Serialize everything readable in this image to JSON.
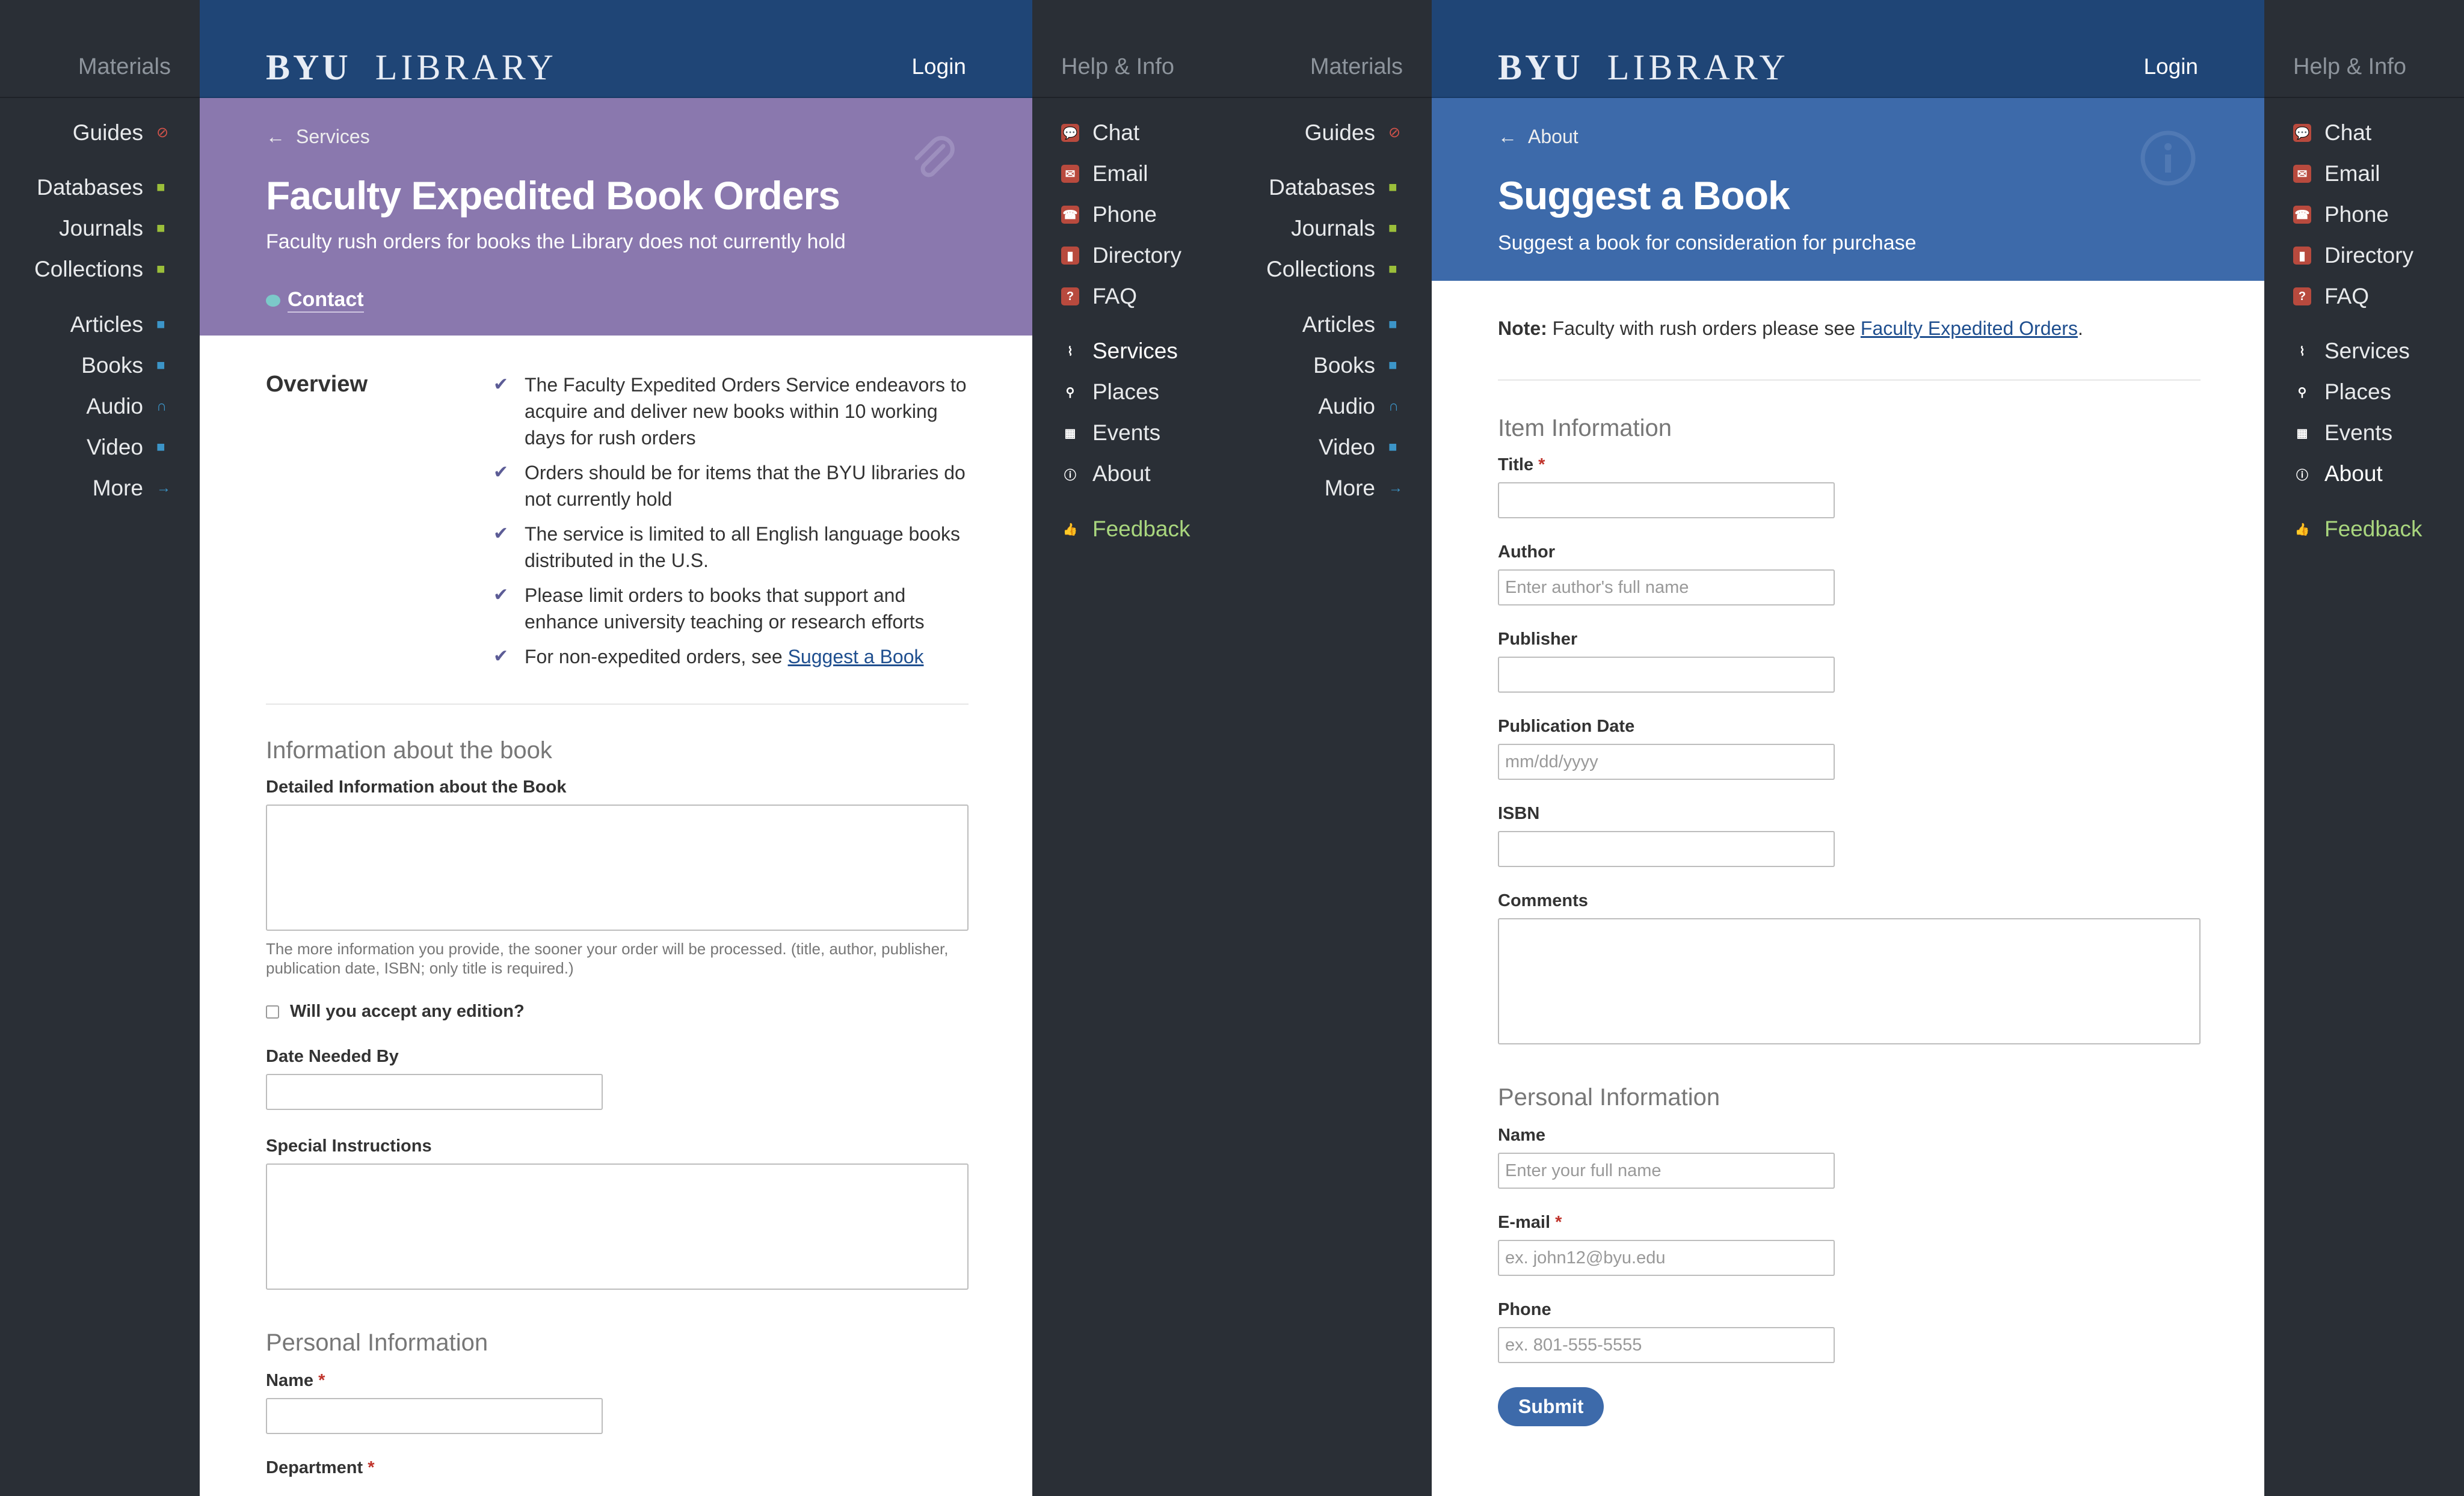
{
  "left_panel": {
    "materials_label": "Materials",
    "items": [
      {
        "label": "Guides",
        "icon": "guides-icon",
        "color": "#d0524a"
      },
      {
        "label": "Databases",
        "icon": "databases-icon",
        "color": "#9bbf3a"
      },
      {
        "label": "Journals",
        "icon": "journals-icon",
        "color": "#9bbf3a"
      },
      {
        "label": "Collections",
        "icon": "collections-icon",
        "color": "#9bbf3a"
      },
      {
        "label": "Articles",
        "icon": "articles-icon",
        "color": "#3c95c8"
      },
      {
        "label": "Books",
        "icon": "books-icon",
        "color": "#3c95c8"
      },
      {
        "label": "Audio",
        "icon": "audio-icon",
        "color": "#3c95c8"
      },
      {
        "label": "Video",
        "icon": "video-icon",
        "color": "#3c95c8"
      },
      {
        "label": "More",
        "icon": "arrow-right-icon",
        "color": "#3c95c8"
      }
    ]
  },
  "page1": {
    "logo_bold": "BYU",
    "logo_text": "LIBRARY",
    "login": "Login",
    "breadcrumb": "Services",
    "title": "Faculty Expedited Book Orders",
    "subtitle": "Faculty rush orders for books the Library does not currently hold",
    "contact": "Contact",
    "hero_color": "#8a78ae",
    "overview_label": "Overview",
    "bullets": [
      "The Faculty Expedited Orders Service endeavors to acquire and deliver new books within 10 working days for rush orders",
      "Orders should be for items that the BYU libraries do not currently hold",
      "The service is limited to all English language books distributed in the U.S.",
      "Please limit orders to books that support and enhance university teaching or research efforts"
    ],
    "last_bullet_prefix": "For non-expedited orders, see ",
    "last_bullet_link": "Suggest a Book",
    "section_book": "Information about the book",
    "detailed_label": "Detailed Information about the Book",
    "detailed_help": "The more information you provide, the sooner your order will be processed. (title, author, publisher, publication date, ISBN; only title is required.)",
    "edition_label": "Will you accept any edition?",
    "date_needed_label": "Date Needed By",
    "special_label": "Special Instructions",
    "section_personal": "Personal Information",
    "name_label": "Name",
    "department_label": "Department",
    "required_mark": "*"
  },
  "middle_panel": {
    "help_label": "Help & Info",
    "materials_label": "Materials",
    "help_items": [
      "Chat",
      "Email",
      "Phone",
      "Directory",
      "FAQ"
    ],
    "site_items": [
      "Services",
      "Places",
      "Events",
      "About"
    ],
    "feedback": "Feedback",
    "selected": "Services"
  },
  "page2": {
    "logo_bold": "BYU",
    "logo_text": "LIBRARY",
    "login": "Login",
    "breadcrumb": "About",
    "title": "Suggest a Book",
    "subtitle": "Suggest a book for consideration for purchase",
    "hero_color": "#3d6aaa",
    "note_bold": "Note:",
    "note_text": " Faculty with rush orders please see ",
    "note_link": "Faculty Expedited Orders",
    "note_end": ".",
    "section_item": "Item Information",
    "title_label": "Title",
    "author_label": "Author",
    "author_placeholder": "Enter author's full name",
    "publisher_label": "Publisher",
    "pubdate_label": "Publication Date",
    "pubdate_placeholder": "mm/dd/yyyy",
    "isbn_label": "ISBN",
    "comments_label": "Comments",
    "section_personal": "Personal Information",
    "name_label": "Name",
    "name_placeholder": "Enter your full name",
    "email_label": "E-mail",
    "email_placeholder": "ex. john12@byu.edu",
    "phone_label": "Phone",
    "phone_placeholder": "ex. 801-555-5555",
    "submit": "Submit",
    "required_mark": "*"
  },
  "right_panel": {
    "help_label": "Help & Info",
    "help_items": [
      "Chat",
      "Email",
      "Phone",
      "Directory",
      "FAQ"
    ],
    "site_items": [
      "Services",
      "Places",
      "Events",
      "About"
    ],
    "feedback": "Feedback",
    "selected": "About"
  }
}
